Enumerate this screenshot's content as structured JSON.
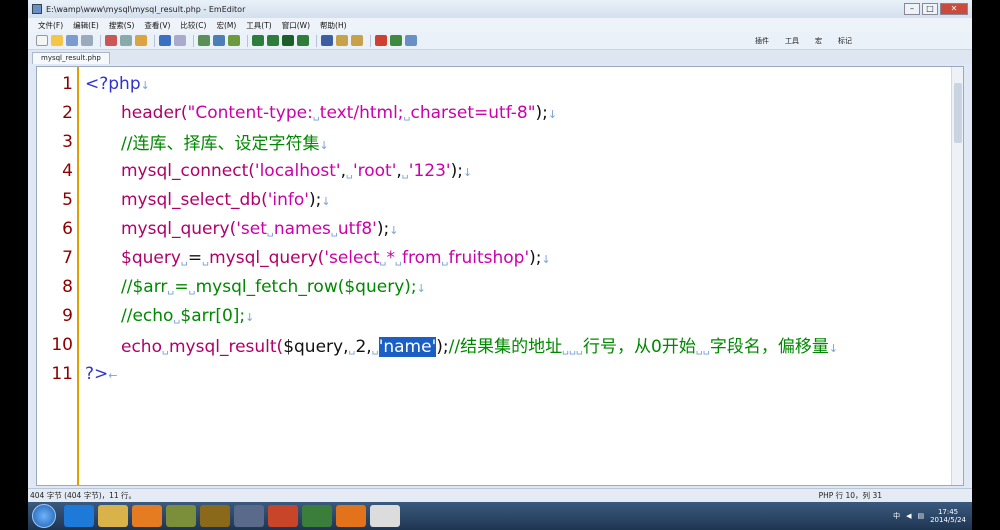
{
  "window": {
    "title": "E:\\wamp\\www\\mysql\\mysql_result.php - EmEditor"
  },
  "menu": [
    "文件(F)",
    "编辑(E)",
    "搜索(S)",
    "查看(V)",
    "比较(C)",
    "宏(M)",
    "工具(T)",
    "窗口(W)",
    "帮助(H)"
  ],
  "toolbar": {
    "plugins_label": "插件",
    "tools_label": "工具",
    "macro_label": "宏",
    "marker_label": "标记"
  },
  "tab": {
    "label": "mysql_result.php"
  },
  "code_lines": [
    {
      "num": "1",
      "tokens": [
        {
          "t": "<?php",
          "c": "c-kw"
        },
        {
          "t": "↓",
          "c": "c-mk"
        }
      ]
    },
    {
      "num": "2",
      "tokens": [
        {
          "t": "header(",
          "c": "c-fn"
        },
        {
          "t": "\"Content-type:",
          "c": "c-str"
        },
        {
          "t": "␣",
          "c": "c-mk"
        },
        {
          "t": "text/html;",
          "c": "c-str"
        },
        {
          "t": "␣",
          "c": "c-mk"
        },
        {
          "t": "charset=utf-8\"",
          "c": "c-str"
        },
        {
          "t": ");",
          "c": "c-plain"
        },
        {
          "t": "↓",
          "c": "c-mk"
        }
      ]
    },
    {
      "num": "3",
      "tokens": [
        {
          "t": "//连库、择库、设定字符集",
          "c": "c-cm"
        },
        {
          "t": "↓",
          "c": "c-mk"
        }
      ]
    },
    {
      "num": "4",
      "tokens": [
        {
          "t": "mysql_connect(",
          "c": "c-fn"
        },
        {
          "t": "'localhost'",
          "c": "c-str"
        },
        {
          "t": ",",
          "c": "c-plain"
        },
        {
          "t": "␣",
          "c": "c-mk"
        },
        {
          "t": "'root'",
          "c": "c-str"
        },
        {
          "t": ",",
          "c": "c-plain"
        },
        {
          "t": "␣",
          "c": "c-mk"
        },
        {
          "t": "'123'",
          "c": "c-str"
        },
        {
          "t": ");",
          "c": "c-plain"
        },
        {
          "t": "↓",
          "c": "c-mk"
        }
      ]
    },
    {
      "num": "5",
      "tokens": [
        {
          "t": "mysql_select_db(",
          "c": "c-fn"
        },
        {
          "t": "'info'",
          "c": "c-str"
        },
        {
          "t": ");",
          "c": "c-plain"
        },
        {
          "t": "↓",
          "c": "c-mk"
        }
      ]
    },
    {
      "num": "6",
      "tokens": [
        {
          "t": "mysql_query(",
          "c": "c-fn"
        },
        {
          "t": "'set",
          "c": "c-str"
        },
        {
          "t": "␣",
          "c": "c-mk"
        },
        {
          "t": "names",
          "c": "c-str"
        },
        {
          "t": "␣",
          "c": "c-mk"
        },
        {
          "t": "utf8'",
          "c": "c-str"
        },
        {
          "t": ");",
          "c": "c-plain"
        },
        {
          "t": "↓",
          "c": "c-mk"
        }
      ]
    },
    {
      "num": "7",
      "tokens": [
        {
          "t": "$query",
          "c": "c-fn"
        },
        {
          "t": "␣",
          "c": "c-mk"
        },
        {
          "t": "=",
          "c": "c-plain"
        },
        {
          "t": "␣",
          "c": "c-mk"
        },
        {
          "t": "mysql_query(",
          "c": "c-fn"
        },
        {
          "t": "'select",
          "c": "c-str"
        },
        {
          "t": "␣",
          "c": "c-mk"
        },
        {
          "t": "*",
          "c": "c-str"
        },
        {
          "t": "␣",
          "c": "c-mk"
        },
        {
          "t": "from",
          "c": "c-str"
        },
        {
          "t": "␣",
          "c": "c-mk"
        },
        {
          "t": "fruitshop'",
          "c": "c-str"
        },
        {
          "t": ");",
          "c": "c-plain"
        },
        {
          "t": "↓",
          "c": "c-mk"
        }
      ]
    },
    {
      "num": "8",
      "tokens": [
        {
          "t": "//$arr",
          "c": "c-cm"
        },
        {
          "t": "␣",
          "c": "c-mk"
        },
        {
          "t": "=",
          "c": "c-cm"
        },
        {
          "t": "␣",
          "c": "c-mk"
        },
        {
          "t": "mysql_fetch_row($query);",
          "c": "c-cm"
        },
        {
          "t": "↓",
          "c": "c-mk"
        }
      ]
    },
    {
      "num": "9",
      "tokens": [
        {
          "t": "//echo",
          "c": "c-cm"
        },
        {
          "t": "␣",
          "c": "c-mk"
        },
        {
          "t": "$arr[0];",
          "c": "c-cm"
        },
        {
          "t": "↓",
          "c": "c-mk"
        }
      ]
    },
    {
      "num": "10",
      "tokens": [
        {
          "t": "echo",
          "c": "c-fn"
        },
        {
          "t": "␣",
          "c": "c-mk"
        },
        {
          "t": "mysql_result(",
          "c": "c-fn"
        },
        {
          "t": "$query,",
          "c": "c-plain"
        },
        {
          "t": "␣",
          "c": "c-mk"
        },
        {
          "t": "2,",
          "c": "c-plain"
        },
        {
          "t": "␣",
          "c": "c-mk"
        },
        {
          "t": "'name'",
          "c": "c-sel"
        },
        {
          "t": ");",
          "c": "c-plain"
        },
        {
          "t": "//结果集的地址",
          "c": "c-cm"
        },
        {
          "t": "␣␣␣",
          "c": "c-mk"
        },
        {
          "t": "行号，从0开始",
          "c": "c-cm"
        },
        {
          "t": "␣␣",
          "c": "c-mk"
        },
        {
          "t": "字段名，偏移量",
          "c": "c-cm"
        },
        {
          "t": "↓",
          "c": "c-mk"
        }
      ]
    },
    {
      "num": "11",
      "tokens": [
        {
          "t": "?>",
          "c": "c-kw"
        },
        {
          "t": "←",
          "c": "c-mk"
        }
      ]
    }
  ],
  "indent_lines": [
    "2",
    "3",
    "4",
    "5",
    "6",
    "7",
    "8",
    "9",
    "10"
  ],
  "status": {
    "left": "404 字节 (404 字节)，11 行。",
    "right": "PHP 行 10，列 31"
  },
  "tray": {
    "time": "17:45",
    "date": "2014/5/24",
    "ime": "中"
  }
}
